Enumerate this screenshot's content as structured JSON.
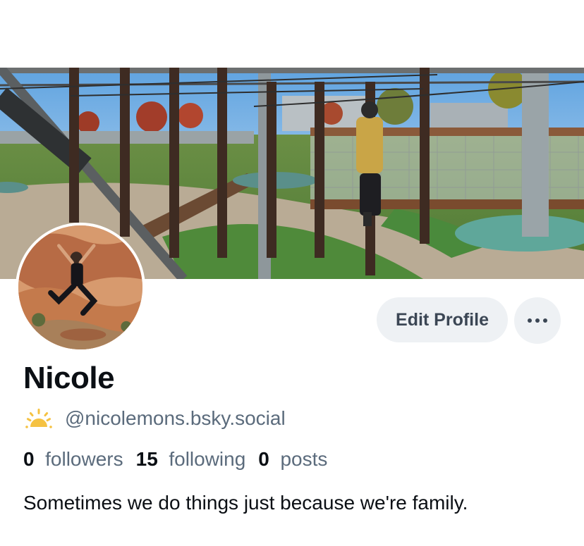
{
  "profile": {
    "display_name": "Nicole",
    "handle": "@nicolemons.bsky.social",
    "bio": "Sometimes we do things just because we're family.",
    "banner_image": "ropes-course-banner",
    "avatar_image": "person-jumping-in-desert-avatar"
  },
  "actions": {
    "edit_profile_label": "Edit Profile",
    "more_icon": "ellipsis-icon"
  },
  "handle_icon": "sunrise-icon",
  "stats": {
    "followers_count": "0",
    "followers_label": "followers",
    "following_count": "15",
    "following_label": "following",
    "posts_count": "0",
    "posts_label": "posts"
  },
  "colors": {
    "button_bg": "#eef1f4",
    "muted_text": "#5b6b7c",
    "icon_yellow": "#f5c242"
  }
}
